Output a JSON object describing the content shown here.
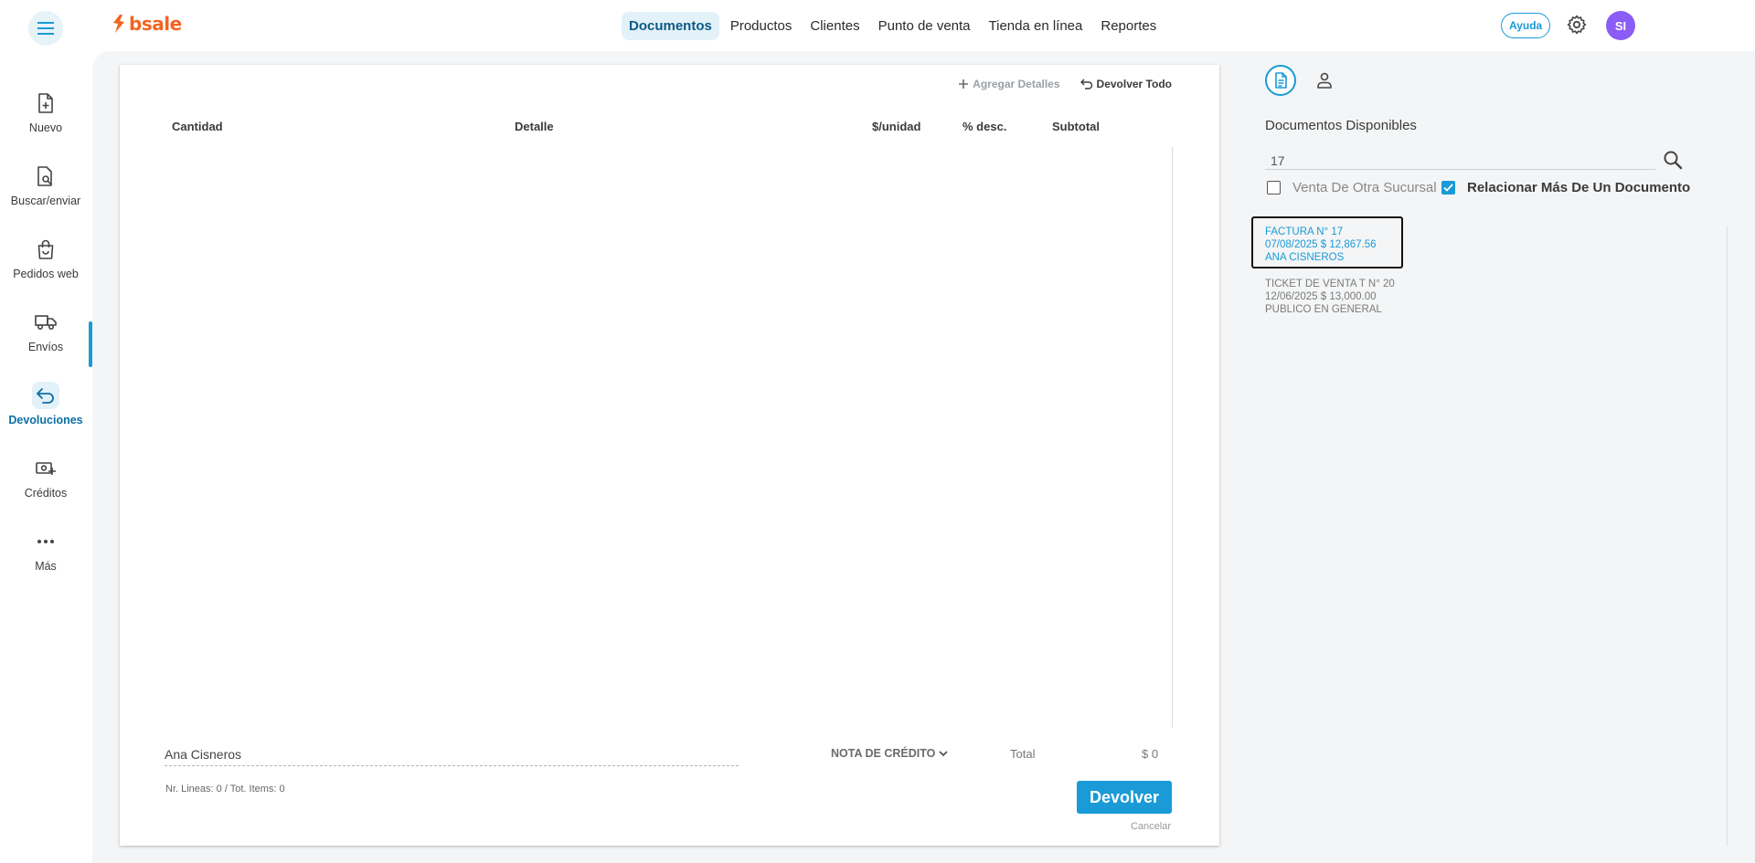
{
  "app": {
    "brand": "bsale",
    "brand_color": "#f26522",
    "accent_color": "#1a9ad6"
  },
  "topnav": {
    "items": [
      {
        "label": "Documentos",
        "active": true
      },
      {
        "label": "Productos"
      },
      {
        "label": "Clientes"
      },
      {
        "label": "Punto de venta"
      },
      {
        "label": "Tienda en línea"
      },
      {
        "label": "Reportes"
      }
    ],
    "help_label": "Ayuda",
    "avatar_initials": "SI"
  },
  "sidebar": {
    "items": [
      {
        "label": "Nuevo",
        "icon": "file-plus-icon"
      },
      {
        "label": "Buscar/enviar",
        "icon": "file-search-icon"
      },
      {
        "label": "Pedidos web",
        "icon": "shopping-bag-icon"
      },
      {
        "label": "Envíos",
        "icon": "truck-icon"
      },
      {
        "label": "Devoluciones",
        "icon": "return-arrow-icon",
        "active": true
      },
      {
        "label": "Créditos",
        "icon": "money-plus-icon"
      },
      {
        "label": "Más",
        "icon": "more-icon"
      }
    ]
  },
  "card": {
    "actions": {
      "add_details": "Agregar Detalles",
      "return_all": "Devolver Todo"
    },
    "columns": {
      "quantity": "Cantidad",
      "detail": "Detalle",
      "unit_price": "$/unidad",
      "discount": "% desc.",
      "subtotal": "Subtotal"
    },
    "client_name": "Ana Cisneros",
    "doc_type": "NOTA DE CRÉDITO",
    "total_label": "Total",
    "total_value": "$ 0",
    "lines_info": "Nr. Lineas: 0 / Tot. Items: 0",
    "return_button": "Devolver",
    "cancel_label": "Cancelar"
  },
  "right_panel": {
    "title": "Documentos Disponibles",
    "search_value": "17",
    "other_branch_label": "Venta De Otra Sucursal",
    "other_branch_checked": false,
    "relate_multiple_label": "Relacionar Más De Un Documento",
    "relate_multiple_checked": true,
    "documents": [
      {
        "line1": "FACTURA N° 17",
        "line2": "07/08/2025 $ 12,867.56",
        "line3": "ANA CISNEROS",
        "selected": true
      },
      {
        "line1": "TICKET DE VENTA T N° 20",
        "line2": "12/06/2025 $ 13,000.00",
        "line3": "PUBLICO EN GENERAL",
        "selected": false
      }
    ]
  }
}
